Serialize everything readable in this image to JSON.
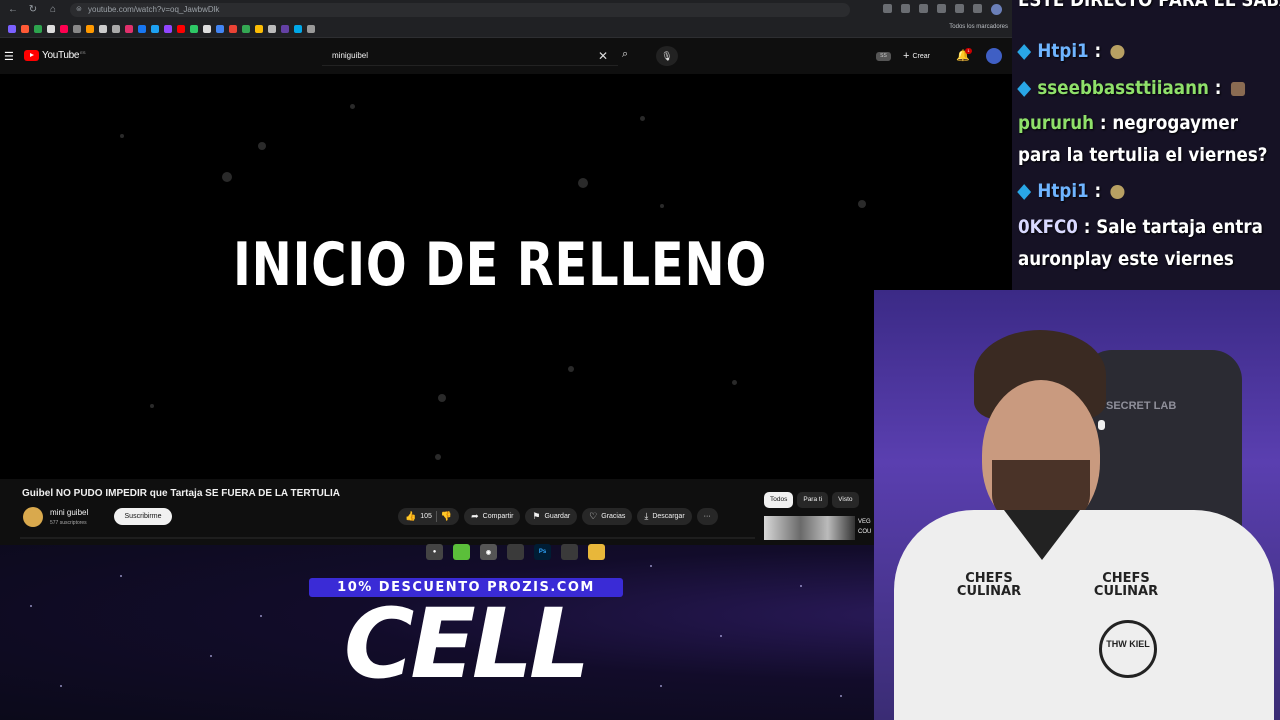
{
  "browser": {
    "url": "youtube.com/watch?v=oq_JawbwDlk",
    "bookmarks_folder_label": "Todos los marcadores"
  },
  "youtube": {
    "logo_text": "YouTube",
    "logo_country": "ES",
    "search_query": "miniguibel",
    "ext_badge": "SS",
    "create_label": "Crear",
    "notifications_count": "1",
    "video_overlay_text": "INICIO DE RELLENO",
    "video_title": "Guibel NO PUDO IMPEDIR que Tartaja SE FUERA DE LA TERTULIA",
    "channel_name": "mini guibel",
    "channel_subscribers": "577 suscriptores",
    "subscribe_label": "Suscribirme",
    "like_count": "105",
    "share_label": "Compartir",
    "save_label": "Guardar",
    "thanks_label": "Gracias",
    "download_label": "Descargar",
    "more_label": "···",
    "chips": [
      "Todos",
      "Para ti",
      "Visto"
    ],
    "rec_title_fragment": "VEG COU"
  },
  "overlay": {
    "promo_text": "10% DESCUENTO PROZIS.COM",
    "brand_text": "CELL",
    "chat_header_fragment": "ESTE DIRECTO PARA EL SÁBADO",
    "chat": [
      {
        "user": "Htpi1",
        "message": "",
        "user_color": "#6fb4ff",
        "emote": "smile",
        "badge": true
      },
      {
        "user": "sseebbassttiiaann",
        "message": "",
        "user_color": "#8fe06a",
        "emote": "cat",
        "badge": true
      },
      {
        "user": "pururuh",
        "message": "negrogaymer para la tertulia el viernes?",
        "user_color": "#8fe06a",
        "emote": "",
        "badge": false
      },
      {
        "user": "Htpi1",
        "message": "",
        "user_color": "#6fb4ff",
        "emote": "smile",
        "badge": true
      },
      {
        "user": "0KFC0",
        "message": "Sale tartaja entra auronplay este viernes",
        "user_color": "#d9d9ff",
        "emote": "",
        "badge": false
      }
    ],
    "shirt_brand": "CHEFS CULINAR",
    "shirt_badge": "THW KIEL",
    "chair_brand": "SECRET LAB"
  },
  "taskbar": [
    "record-app",
    "messages-app",
    "chrome-app",
    "app-4",
    "photoshop-app",
    "app-6",
    "files-app"
  ],
  "colors": {
    "youtube_red": "#ff0000",
    "promo_blue": "#3a2bd6",
    "chat_badge": "#29a6e6"
  }
}
